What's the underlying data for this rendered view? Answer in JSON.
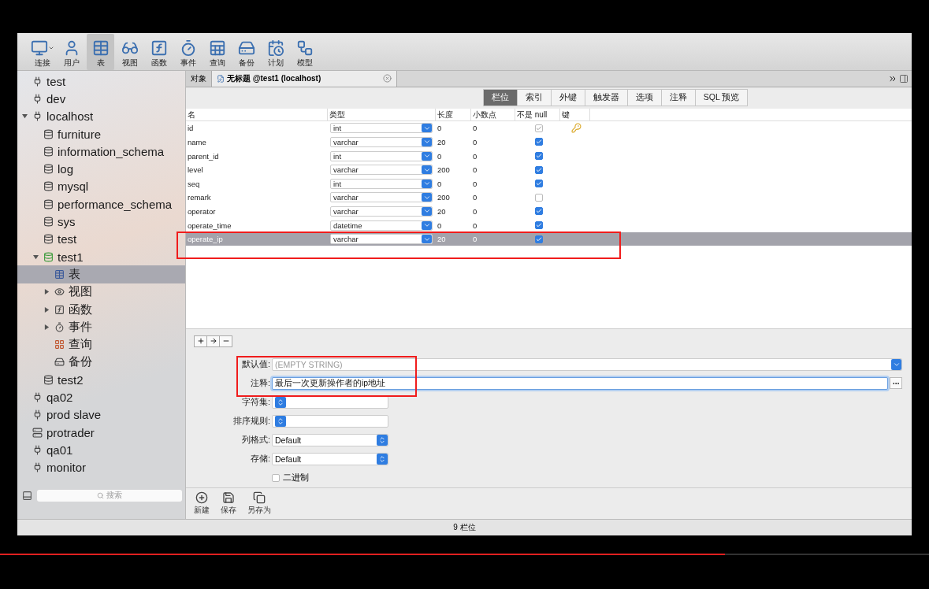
{
  "toolbar": {
    "items": [
      {
        "label": "连接",
        "selected": false,
        "has_menu": true
      },
      {
        "label": "用户",
        "selected": false
      },
      {
        "label": "表",
        "selected": true
      },
      {
        "label": "视图",
        "selected": false
      },
      {
        "label": "函数",
        "selected": false
      },
      {
        "label": "事件",
        "selected": false
      },
      {
        "label": "查询",
        "selected": false
      },
      {
        "label": "备份",
        "selected": false
      },
      {
        "label": "计划",
        "selected": false
      },
      {
        "label": "模型",
        "selected": false
      }
    ]
  },
  "sidebar": {
    "tree": [
      {
        "label": "test",
        "kind": "connection",
        "selected": false
      },
      {
        "label": "dev",
        "kind": "connection",
        "selected": false
      },
      {
        "label": "localhost",
        "kind": "connection",
        "selected": false,
        "expanded": true,
        "children": [
          {
            "label": "furniture",
            "kind": "database",
            "selected": false
          },
          {
            "label": "information_schema",
            "kind": "database",
            "selected": false
          },
          {
            "label": "log",
            "kind": "database",
            "selected": false
          },
          {
            "label": "mysql",
            "kind": "database",
            "selected": false
          },
          {
            "label": "performance_schema",
            "kind": "database",
            "selected": false
          },
          {
            "label": "sys",
            "kind": "database",
            "selected": false
          },
          {
            "label": "test",
            "kind": "database",
            "selected": false
          },
          {
            "label": "test1",
            "kind": "open_database",
            "selected": false,
            "expanded": true,
            "children": [
              {
                "label": "表",
                "kind": "table",
                "selected": true
              },
              {
                "label": "视图",
                "kind": "view",
                "selected": false,
                "expanded": false
              },
              {
                "label": "函数",
                "kind": "function",
                "selected": false,
                "expanded": false
              },
              {
                "label": "事件",
                "kind": "event",
                "selected": false,
                "expanded": false
              },
              {
                "label": "查询",
                "kind": "query",
                "selected": false
              },
              {
                "label": "备份",
                "kind": "backup",
                "selected": false
              }
            ]
          },
          {
            "label": "test2",
            "kind": "database",
            "selected": false
          }
        ]
      },
      {
        "label": "qa02",
        "kind": "connection",
        "selected": false
      },
      {
        "label": "prod slave",
        "kind": "connection",
        "selected": false
      },
      {
        "label": "protrader",
        "kind": "server",
        "selected": false
      },
      {
        "label": "qa01",
        "kind": "connection",
        "selected": false
      },
      {
        "label": "monitor",
        "kind": "connection",
        "selected": false
      }
    ],
    "search": {
      "placeholder": "搜索"
    }
  },
  "doc_tabs": [
    {
      "label": "对象",
      "selected": false
    },
    {
      "label": "无标题 @test1 (localhost)",
      "selected": true,
      "closable": true
    }
  ],
  "sub_tabs": [
    {
      "label": "栏位",
      "selected": true
    },
    {
      "label": "索引",
      "selected": false
    },
    {
      "label": "外键",
      "selected": false
    },
    {
      "label": "触发器",
      "selected": false
    },
    {
      "label": "选项",
      "selected": false
    },
    {
      "label": "注释",
      "selected": false
    },
    {
      "label": "SQL 预览",
      "selected": false
    }
  ],
  "grid": {
    "columns": [
      "名",
      "类型",
      "长度",
      "小数点",
      "不是 null",
      "键"
    ],
    "rows": [
      {
        "name": "id",
        "type": "int",
        "length": "0",
        "decimals": "0",
        "not_null": true,
        "primary_key": true,
        "selected": false
      },
      {
        "name": "name",
        "type": "varchar",
        "length": "20",
        "decimals": "0",
        "not_null": true,
        "primary_key": false,
        "selected": false
      },
      {
        "name": "parent_id",
        "type": "int",
        "length": "0",
        "decimals": "0",
        "not_null": true,
        "primary_key": false,
        "selected": false
      },
      {
        "name": "level",
        "type": "varchar",
        "length": "200",
        "decimals": "0",
        "not_null": true,
        "primary_key": false,
        "selected": false
      },
      {
        "name": "seq",
        "type": "int",
        "length": "0",
        "decimals": "0",
        "not_null": true,
        "primary_key": false,
        "selected": false
      },
      {
        "name": "remark",
        "type": "varchar",
        "length": "200",
        "decimals": "0",
        "not_null": false,
        "primary_key": false,
        "selected": false
      },
      {
        "name": "operator",
        "type": "varchar",
        "length": "20",
        "decimals": "0",
        "not_null": true,
        "primary_key": false,
        "selected": false
      },
      {
        "name": "operate_time",
        "type": "datetime",
        "length": "0",
        "decimals": "0",
        "not_null": true,
        "primary_key": false,
        "selected": false
      },
      {
        "name": "operate_ip",
        "type": "varchar",
        "length": "20",
        "decimals": "0",
        "not_null": true,
        "primary_key": false,
        "selected": true
      }
    ]
  },
  "properties": {
    "fields": [
      {
        "label": "默认值:",
        "kind": "combo",
        "placeholder": "(EMPTY STRING)"
      },
      {
        "label": "注释:",
        "kind": "text",
        "value": "最后一次更新操作者的ip地址",
        "focused": true
      },
      {
        "label": "字符集:",
        "kind": "select"
      },
      {
        "label": "排序规则:",
        "kind": "select"
      },
      {
        "label": "列格式:",
        "kind": "select",
        "value": "Default"
      },
      {
        "label": "存储:",
        "kind": "select",
        "value": "Default"
      }
    ],
    "binary": {
      "label": "二进制",
      "checked": false
    }
  },
  "actions": [
    "新建",
    "保存",
    "另存为"
  ],
  "status_bar": "9 栏位",
  "video": {
    "level": 0.78
  }
}
